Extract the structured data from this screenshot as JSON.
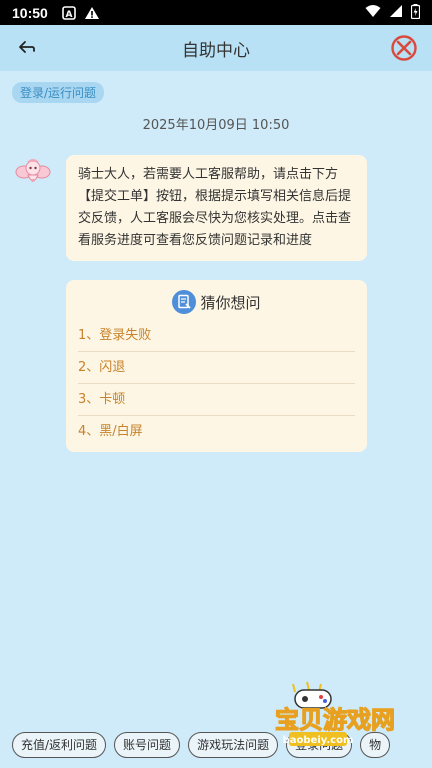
{
  "status_bar": {
    "time": "10:50",
    "app_icon": "a-box-icon",
    "alert_icon": "warning-icon",
    "wifi_icon": "wifi-icon",
    "signal_icon": "signal-icon",
    "battery_icon": "battery-icon"
  },
  "header": {
    "title": "自助中心",
    "back_icon": "back-arrow-icon",
    "close_icon": "close-circle-icon"
  },
  "conversation": {
    "category_tag": "登录/运行问题",
    "timestamp": "2025年10月09日 10:50",
    "message": "骑士大人，若需要人工客服帮助，请点击下方【提交工单】按钮，根据提示填写相关信息后提交反馈，人工客服会尽快为您核实处理。点击查看服务进度可查看您反馈问题记录和进度"
  },
  "faq": {
    "title": "猜你想问",
    "items": [
      "1、登录失败",
      "2、闪退",
      "3、卡顿",
      "4、黑/白屏"
    ]
  },
  "bottom_tabs": [
    "充值/返利问题",
    "账号问题",
    "游戏玩法问题",
    "登录问题",
    "物"
  ],
  "watermark": {
    "text": "宝贝游戏网",
    "url": "baobeiy.com"
  },
  "colors": {
    "page_bg": "#cfeaf8",
    "header_bg": "#b8e1f5",
    "bubble_bg": "#fdf6e4",
    "faq_item": "#c7832b",
    "tag_bg": "#a9d6f0"
  }
}
